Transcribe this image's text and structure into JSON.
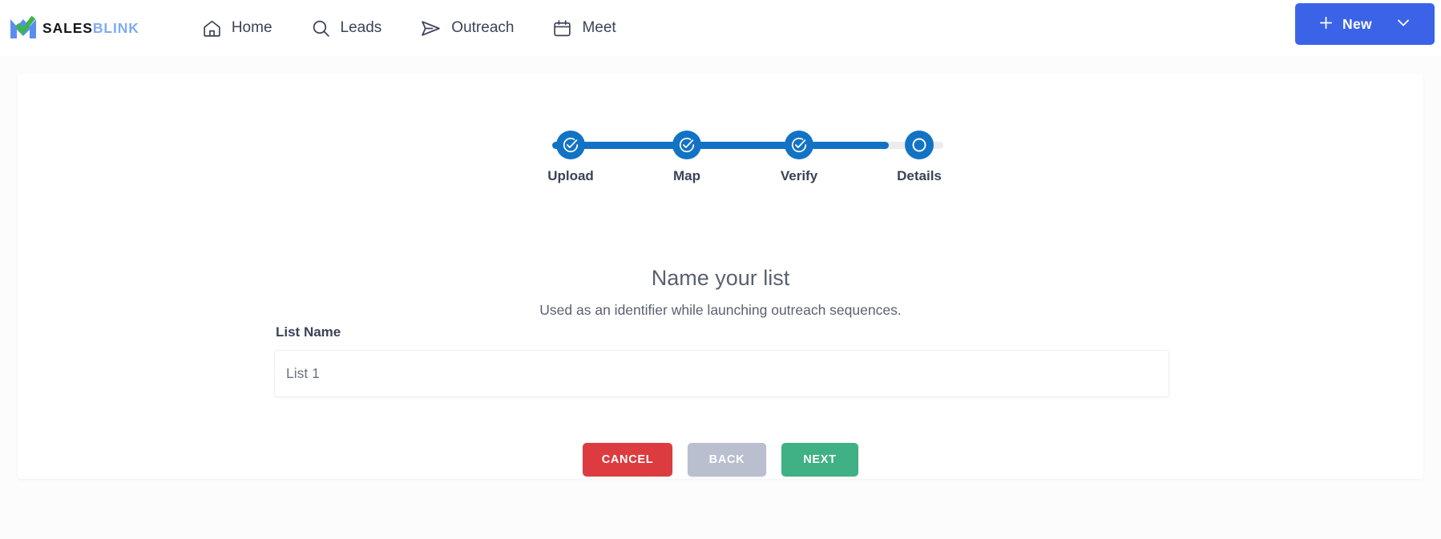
{
  "app": {
    "logo_sales": "SALES",
    "logo_blink": "BLINK",
    "logo_icon": "salesblink-checkmark-logo",
    "brand_blue": "#3b63e8",
    "brand_light_blue": "#7fabf0",
    "brand_green": "#3cb54a"
  },
  "nav": {
    "items": [
      {
        "label": "Home",
        "icon": "home-icon"
      },
      {
        "label": "Leads",
        "icon": "search-icon"
      },
      {
        "label": "Outreach",
        "icon": "send-icon"
      },
      {
        "label": "Meet",
        "icon": "calendar-icon"
      }
    ],
    "new_button": {
      "label": "New",
      "plus_icon": "plus-icon",
      "chevron_icon": "chevron-down-icon",
      "color": "#3b63e8"
    }
  },
  "wizard": {
    "steps": [
      {
        "label": "Upload",
        "state": "completed",
        "icon": "check-circle-icon"
      },
      {
        "label": "Map",
        "state": "completed",
        "icon": "check-circle-icon"
      },
      {
        "label": "Verify",
        "state": "completed",
        "icon": "check-circle-icon"
      },
      {
        "label": "Details",
        "state": "current",
        "icon": "empty-circle-icon"
      }
    ],
    "progress_color": "#1273c4",
    "track_color": "#ececef"
  },
  "main": {
    "title": "Name your list",
    "subtitle": "Used as an identifier while launching outreach sequences.",
    "form": {
      "list_name_label": "List Name",
      "list_name_value": "List 1",
      "list_name_placeholder": "List 1"
    },
    "buttons": {
      "cancel": "CANCEL",
      "back": "BACK",
      "next": "NEXT",
      "cancel_color": "#dc3c40",
      "back_color": "#b9bfcf",
      "next_color": "#3fb184"
    }
  }
}
